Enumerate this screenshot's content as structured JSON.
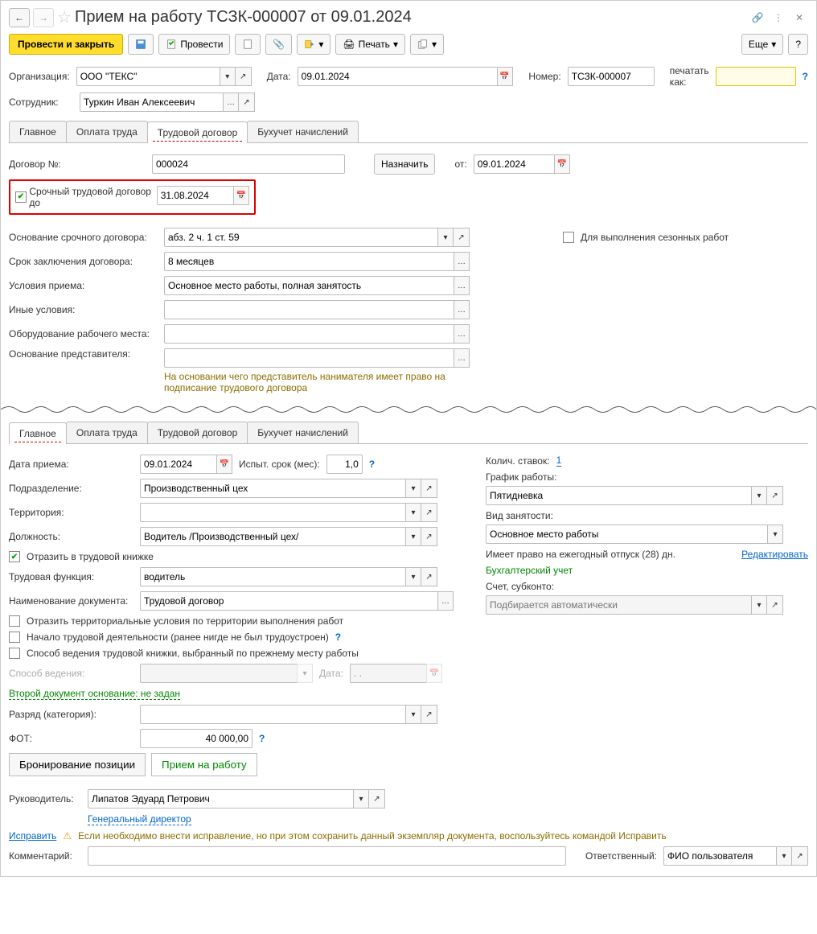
{
  "title": "Прием на работу ТСЗК-000007 от 09.01.2024",
  "toolbar": {
    "post_close": "Провести и закрыть",
    "post": "Провести",
    "print": "Печать",
    "more": "Еще"
  },
  "header": {
    "org_label": "Организация:",
    "org_value": "ООО \"ТЕКС\"",
    "date_label": "Дата:",
    "date_value": "09.01.2024",
    "number_label": "Номер:",
    "number_value": "ТСЗК-000007",
    "print_as_label": "печатать как:",
    "print_as_value": "",
    "employee_label": "Сотрудник:",
    "employee_value": "Туркин Иван Алексеевич"
  },
  "tabs1": {
    "t1": "Главное",
    "t2": "Оплата труда",
    "t3": "Трудовой договор",
    "t4": "Бухучет начислений"
  },
  "contract": {
    "num_label": "Договор №:",
    "num_value": "000024",
    "assign": "Назначить",
    "from_label": "от:",
    "from_value": "09.01.2024",
    "urgent_label": "Срочный трудовой договор до",
    "urgent_date": "31.08.2024",
    "basis_label": "Основание срочного договора:",
    "basis_value": "абз. 2 ч. 1 ст. 59",
    "seasonal_label": "Для выполнения сезонных работ",
    "term_label": "Срок заключения договора:",
    "term_value": "8 месяцев",
    "conditions_label": "Условия приема:",
    "conditions_value": "Основное место работы, полная занятость",
    "other_label": "Иные условия:",
    "equip_label": "Оборудование рабочего места:",
    "rep_label": "Основание представителя:",
    "rep_hint": "На основании чего представитель нанимателя имеет право на подписание трудового договора"
  },
  "tabs2": {
    "t1": "Главное",
    "t2": "Оплата труда",
    "t3": "Трудовой договор",
    "t4": "Бухучет начислений"
  },
  "main": {
    "hire_date_label": "Дата приема:",
    "hire_date_value": "09.01.2024",
    "probation_label": "Испыт. срок (мес):",
    "probation_value": "1,0",
    "dept_label": "Подразделение:",
    "dept_value": "Производственный цех",
    "territory_label": "Территория:",
    "position_label": "Должность:",
    "position_value": "Водитель /Производственный цех/",
    "reflect_label": "Отразить в трудовой книжке",
    "func_label": "Трудовая функция:",
    "func_value": "водитель",
    "docname_label": "Наименование документа:",
    "docname_value": "Трудовой договор",
    "territorial_label": "Отразить территориальные условия по территории выполнения работ",
    "first_job_label": "Начало трудовой деятельности (ранее нигде не был трудоустроен)",
    "book_method_label": "Способ ведения трудовой книжки, выбранный по прежнему месту работы",
    "method_label": "Способ ведения:",
    "method_date_label": "Дата:",
    "method_date_value": ". .",
    "second_doc": "Второй документ основание: не задан",
    "grade_label": "Разряд (категория):",
    "fot_label": "ФОТ:",
    "fot_value": "40 000,00",
    "booking_btn": "Бронирование позиции",
    "hire_btn": "Прием на работу",
    "rates_label": "Колич. ставок:",
    "rates_value": "1",
    "schedule_label": "График работы:",
    "schedule_value": "Пятидневка",
    "employment_label": "Вид занятости:",
    "employment_value": "Основное место работы",
    "vacation_label": "Имеет право на ежегодный отпуск (28) дн.",
    "edit_link": "Редактировать",
    "accounting_label": "Бухгалтерский учет",
    "account_label": "Счет, субконто:",
    "account_placeholder": "Подбирается автоматически"
  },
  "footer": {
    "manager_label": "Руководитель:",
    "manager_value": "Липатов Эдуард Петрович",
    "manager_title": "Генеральный директор",
    "fix_link": "Исправить",
    "fix_note": "Если необходимо внести исправление, но при этом сохранить данный экземпляр документа, воспользуйтесь командой Исправить",
    "comment_label": "Комментарий:",
    "responsible_label": "Ответственный:",
    "responsible_value": "ФИО пользователя"
  }
}
